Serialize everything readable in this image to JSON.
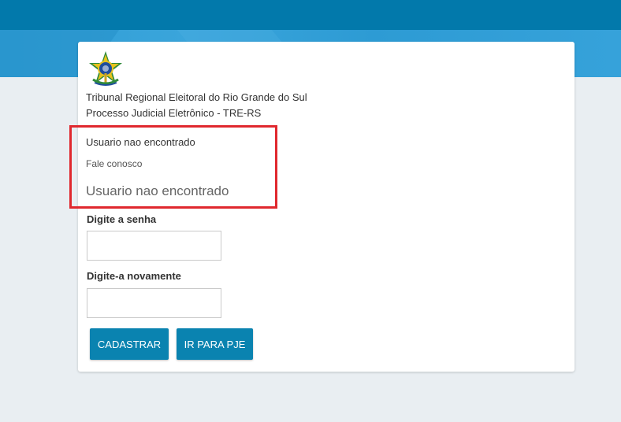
{
  "colors": {
    "topbar": "#0279ab",
    "band": "#2f9dd5",
    "background": "#e9eef2",
    "button": "#0a83b0",
    "highlight": "#e0282e"
  },
  "header": {
    "logo_icon": "brazil-coat-of-arms-icon",
    "org_name": "Tribunal Regional Eleitoral do Rio Grande do Sul",
    "system_name": "Processo Judicial Eletrônico - TRE-RS"
  },
  "messages": {
    "status": "Usuario nao encontrado",
    "contact_link": "Fale conosco",
    "status_large": "Usuario nao encontrado"
  },
  "form": {
    "password_label": "Digite a senha",
    "password_value": "",
    "confirm_label": "Digite-a novamente",
    "confirm_value": ""
  },
  "buttons": {
    "register": "CADASTRAR",
    "go_pje": "IR PARA PJE"
  }
}
